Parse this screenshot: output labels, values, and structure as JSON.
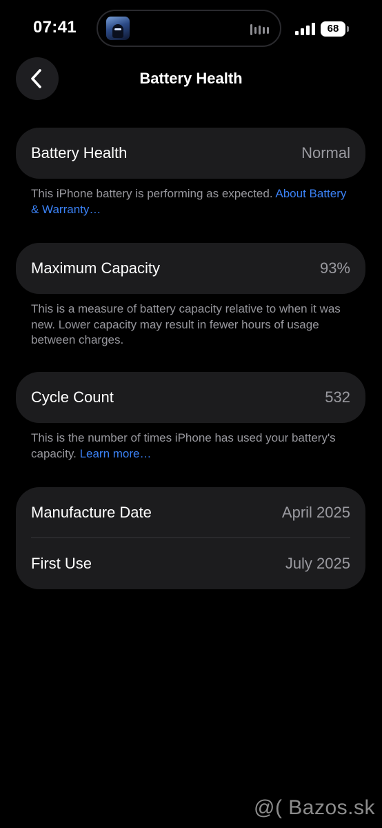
{
  "status_bar": {
    "time": "07:41",
    "battery_level": "68"
  },
  "nav": {
    "title": "Battery Health"
  },
  "battery_health": {
    "label": "Battery Health",
    "value": "Normal",
    "footnote": "This iPhone battery is performing as expected.",
    "link": "About Battery & Warranty…"
  },
  "maximum_capacity": {
    "label": "Maximum Capacity",
    "value": "93%",
    "footnote": "This is a measure of battery capacity relative to when it was new. Lower capacity may result in fewer hours of usage between charges."
  },
  "cycle_count": {
    "label": "Cycle Count",
    "value": "532",
    "footnote": "This is the number of times iPhone has used your battery's capacity.",
    "link": "Learn more…"
  },
  "dates": {
    "manufacture_label": "Manufacture Date",
    "manufacture_value": "April 2025",
    "first_use_label": "First Use",
    "first_use_value": "July 2025"
  },
  "watermark": "@( Bazos.sk",
  "colors": {
    "background": "#000000",
    "card": "#1c1c1e",
    "secondary_text": "#98989e",
    "link": "#3b82f6"
  }
}
